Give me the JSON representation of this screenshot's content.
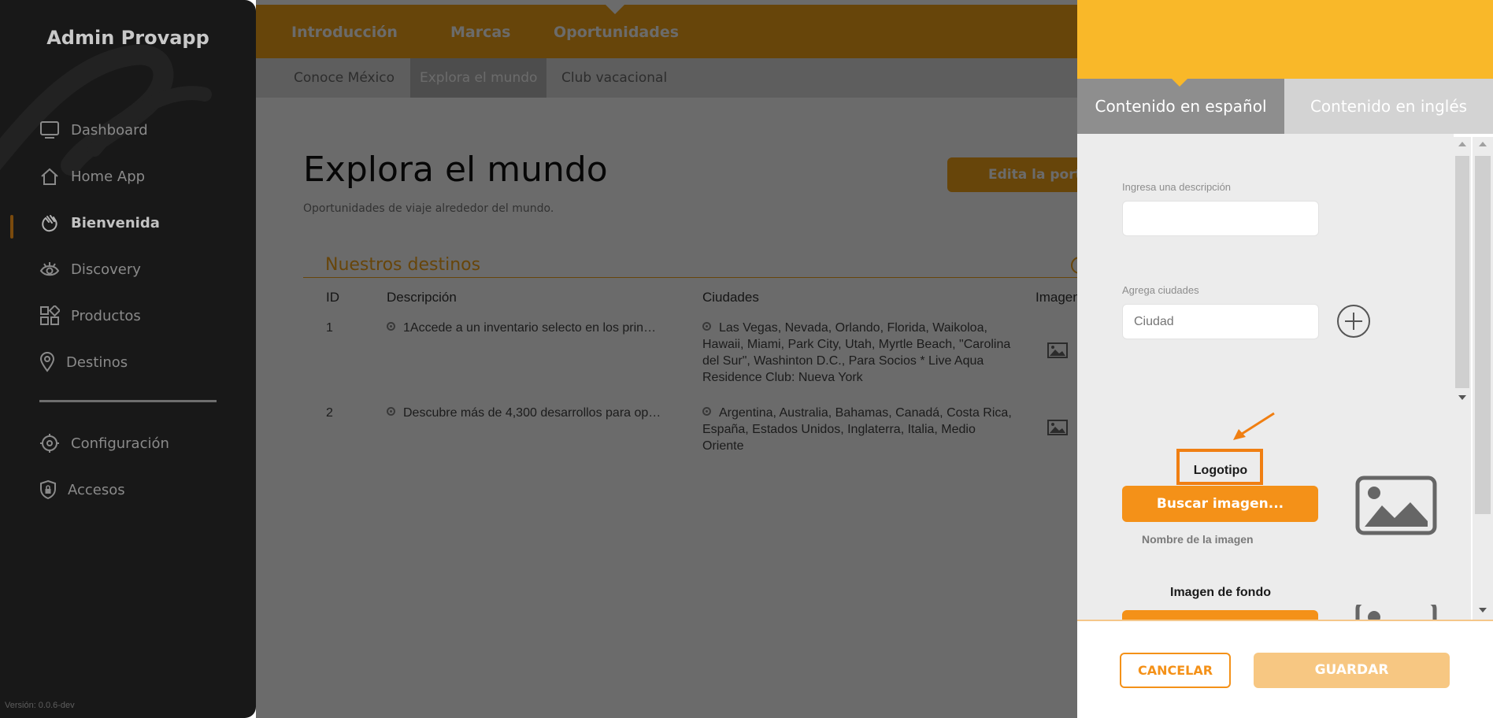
{
  "sidebar": {
    "brand": "Admin Provapp",
    "items": [
      {
        "label": "Dashboard",
        "icon": "monitor-icon"
      },
      {
        "label": "Home App",
        "icon": "home-icon"
      },
      {
        "label": "Bienvenida",
        "icon": "waving-hand-icon",
        "active": true
      },
      {
        "label": "Discovery",
        "icon": "eye-icon"
      },
      {
        "label": "Productos",
        "icon": "grid-shapes-icon"
      },
      {
        "label": "Destinos",
        "icon": "location-pin-icon"
      },
      {
        "label": "Configuración",
        "icon": "gear-icon"
      },
      {
        "label": "Accesos",
        "icon": "shield-lock-icon"
      }
    ],
    "version": "Versión: 0.0.6-dev"
  },
  "topnav": {
    "items": [
      "Introducción",
      "Marcas",
      "Oportunidades"
    ],
    "active": "Oportunidades"
  },
  "subnav": {
    "items": [
      "Conoce México",
      "Explora el mundo",
      "Club vacacional"
    ],
    "active": "Explora el mundo"
  },
  "main": {
    "title": "Explora el mundo",
    "subtitle": "Oportunidades de viaje alrededor del mundo.",
    "edit_button": "Edita la portada",
    "section_title": "Nuestros destinos",
    "table": {
      "headers": [
        "ID",
        "Descripción",
        "Ciudades",
        "Imagen"
      ],
      "rows": [
        {
          "id": "1",
          "description": "1Accede a un inventario selecto en los prin…",
          "cities": "Las Vegas, Nevada, Orlando, Florida, Waikoloa, Hawaii, Miami, Park City, Utah, Myrtle Beach, \"Carolina del Sur\", Washinton D.C., Para Socios * Live Aqua Residence Club: Nueva York"
        },
        {
          "id": "2",
          "description": "Descubre más de 4,300 desarrollos para op…",
          "cities": "Argentina, Australia, Bahamas, Canadá, Costa Rica, España, Estados Unidos, Inglaterra, Italia, Medio Oriente"
        }
      ]
    }
  },
  "panel": {
    "tabs": [
      "Contenido en español",
      "Contenido en inglés"
    ],
    "description_label": "Ingresa una descripción",
    "description_value": "",
    "cities_label": "Agrega ciudades",
    "city_placeholder": "Ciudad",
    "logo_title": "Logotipo",
    "search_image_button": "Buscar imagen...",
    "image_name": "Nombre de la imagen",
    "background_title": "Imagen de fondo",
    "cancel_button": "CANCELAR",
    "save_button": "GUARDAR"
  },
  "colors": {
    "accent": "#f5a418",
    "panel_header": "#f9b829",
    "highlight_frame": "#f07f12",
    "sidebar_bg": "#181818"
  }
}
